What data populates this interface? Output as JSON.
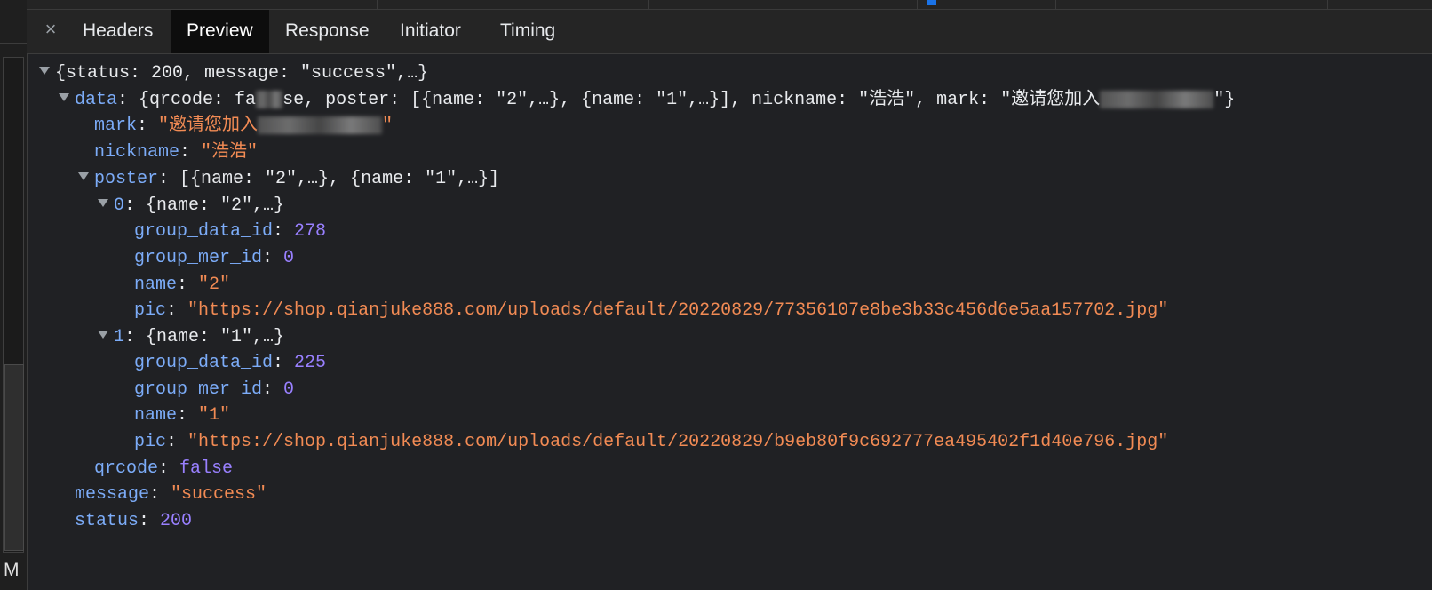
{
  "tabs": {
    "close_glyph": "×",
    "items": [
      "Headers",
      "Preview",
      "Response",
      "Initiator",
      "Timing"
    ],
    "active": "Preview"
  },
  "gutter": {
    "letter": "M"
  },
  "preview": {
    "root_summary": "{status: 200, message: \"success\",…}",
    "data_key": "data",
    "data_summary_a": "{qrcode: fa",
    "data_summary_b": "se, poster: [{name: \"2\",…}, {name: \"1\",…}], nickname: \"浩浩\", mark: \"邀请您加入",
    "data_summary_c": "\"}",
    "mark_key": "mark",
    "mark_value_visible": "\"邀请您加入",
    "mark_value_end": "\"",
    "nickname_key": "nickname",
    "nickname_value": "\"浩浩\"",
    "poster_key": "poster",
    "poster_summary": "[{name: \"2\",…}, {name: \"1\",…}]",
    "items": [
      {
        "index": "0",
        "summary": "{name: \"2\",…}",
        "group_data_id": "278",
        "group_mer_id": "0",
        "name": "\"2\"",
        "pic": "\"https://shop.qianjuke888.com/uploads/default/20220829/77356107e8be3b33c456d6e5aa157702.jpg\""
      },
      {
        "index": "1",
        "summary": "{name: \"1\",…}",
        "group_data_id": "225",
        "group_mer_id": "0",
        "name": "\"1\"",
        "pic": "\"https://shop.qianjuke888.com/uploads/default/20220829/b9eb80f9c692777ea495402f1d40e796.jpg\""
      }
    ],
    "labels": {
      "group_data_id": "group_data_id",
      "group_mer_id": "group_mer_id",
      "name": "name",
      "pic": "pic"
    },
    "qrcode_key": "qrcode",
    "qrcode_value": "false",
    "message_key": "message",
    "message_value": "\"success\"",
    "status_key": "status",
    "status_value": "200",
    "colors": {
      "key": "#7cacf8",
      "string": "#f28b54",
      "number": "#9980ff",
      "background": "#202124"
    }
  }
}
